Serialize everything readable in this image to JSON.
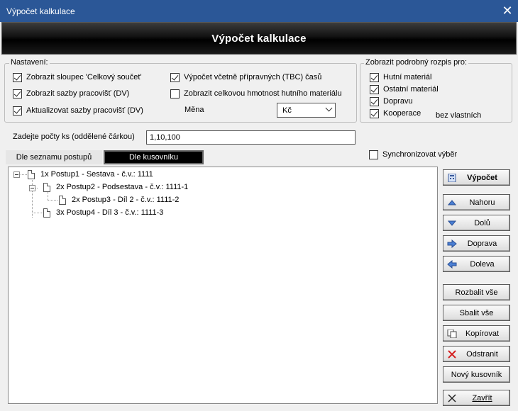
{
  "window": {
    "title": "Výpočet kalkulace",
    "close_glyph": "✕"
  },
  "banner": {
    "title": "Výpočet kalkulace"
  },
  "settings": {
    "legend": "Nastavení:",
    "options": [
      {
        "label": "Zobrazit sloupec 'Celkový součet'",
        "checked": true
      },
      {
        "label": "Zobrazit sazby pracovišť (DV)",
        "checked": true
      },
      {
        "label": "Aktualizovat sazby pracovišť (DV)",
        "checked": true
      },
      {
        "label": "Výpočet včetně přípravných (TBC) časů",
        "checked": true
      },
      {
        "label": "Zobrazit celkovou hmotnost hutního materiálu",
        "checked": false
      }
    ],
    "currency_label": "Měna",
    "currency_value": "Kč"
  },
  "detail": {
    "legend": "Zobrazit podrobný rozpis pro:",
    "options": [
      {
        "label": "Hutní materiál",
        "checked": true
      },
      {
        "label": "Ostatní materiál",
        "checked": true
      },
      {
        "label": "Dopravu",
        "checked": true
      },
      {
        "label": "Kooperace",
        "checked": true
      }
    ],
    "extra_label": "bez vlastních"
  },
  "quantity": {
    "label": "Zadejte počty ks (oddělené čárkou)",
    "value": "1,10,100"
  },
  "tabs": [
    {
      "label": "Dle seznamu postupů",
      "active": false
    },
    {
      "label": "Dle kusovníku",
      "active": true
    }
  ],
  "sync_label": "Synchronizovat výběr",
  "sync_checked": false,
  "tree": [
    {
      "label": "1x Postup1 - Sestava - č.v.: 1111",
      "level": 0
    },
    {
      "label": "2x Postup2 - Podsestava - č.v.: 1111-1",
      "level": 1
    },
    {
      "label": "2x Postup3 - Díl 2 - č.v.: 1111-2",
      "level": 2
    },
    {
      "label": "3x Postup4 - Díl 3 - č.v.: 1111-3",
      "level": 1
    }
  ],
  "buttons": {
    "calculate": "Výpočet",
    "up": "Nahoru",
    "down": "Dolů",
    "right": "Doprava",
    "left": "Doleva",
    "expand_all": "Rozbalit vše",
    "collapse_all": "Sbalit vše",
    "copy": "Kopírovat",
    "remove": "Odstranit",
    "new_bom": "Nový kusovník",
    "close": "Zavřít"
  },
  "colors": {
    "titlebar": "#2b5797",
    "banner": "#000000",
    "active_tab": "#000000"
  }
}
